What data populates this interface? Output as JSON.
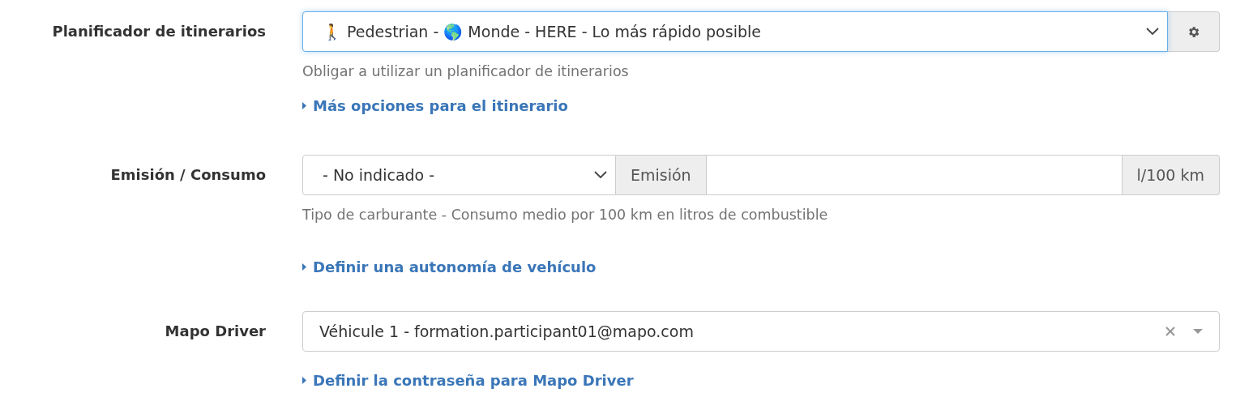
{
  "rows": [
    {
      "kind": "route",
      "label": "Planificador de itinerarios",
      "select": {
        "value": "🚶 Pedestrian - 🌎 Monde - HERE - Lo más rápido posible",
        "focused": true
      },
      "help": "Obligar a utilizar un planificador de itinerarios",
      "link": "Más opciones para el itinerario"
    },
    {
      "kind": "emission",
      "label": "Emisión / Consumo",
      "select": {
        "value": "- No indicado -",
        "focused": false
      },
      "addon": "Emisión",
      "unit": "l/100 km",
      "help": "Tipo de carburante - Consumo medio por 100 km en litros de combustible",
      "link": "Definir una autonomía de vehículo"
    },
    {
      "kind": "driver",
      "label": "Mapo Driver",
      "select": {
        "value": "Véhicule 1 - formation.participant01@mapo.com",
        "focused": false
      },
      "link": "Definir la contraseña para Mapo Driver"
    }
  ]
}
